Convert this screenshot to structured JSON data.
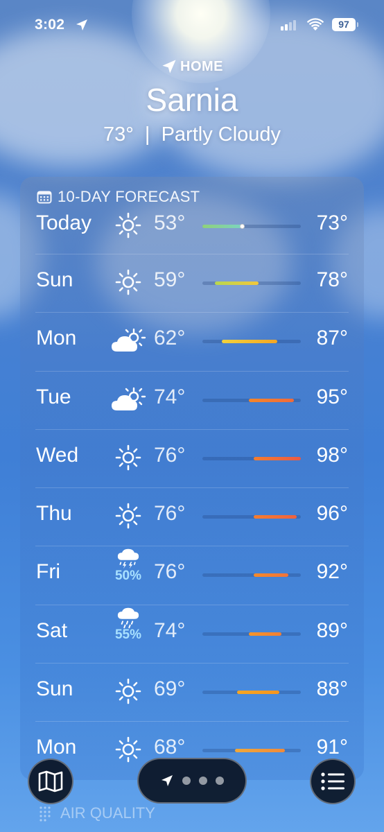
{
  "status": {
    "time": "3:02",
    "battery": "97"
  },
  "header": {
    "location_label": "HOME",
    "city": "Sarnia",
    "conditions": "73°  |  Partly Cloudy"
  },
  "forecast": {
    "title": "10-DAY FORECAST",
    "rows": [
      {
        "day": "Today",
        "icon": "sun-icon",
        "precip": "",
        "low": "53°",
        "high": "73°",
        "bar_start": 0.0,
        "bar_end": 0.4,
        "current": 0.4,
        "bar_color": "linear-gradient(90deg,#8fd27a,#7bd3c0)"
      },
      {
        "day": "Sun",
        "icon": "sun-icon",
        "precip": "",
        "low": "59°",
        "high": "78°",
        "bar_start": 0.13,
        "bar_end": 0.57,
        "bar_color": "linear-gradient(90deg,#b8d74f,#f2c73c)"
      },
      {
        "day": "Mon",
        "icon": "partly-cloudy-icon",
        "precip": "",
        "low": "62°",
        "high": "87°",
        "bar_start": 0.2,
        "bar_end": 0.76,
        "bar_color": "linear-gradient(90deg,#f2d23c,#f5a623)"
      },
      {
        "day": "Tue",
        "icon": "partly-cloudy-icon",
        "precip": "",
        "low": "74°",
        "high": "95°",
        "bar_start": 0.47,
        "bar_end": 0.93,
        "bar_color": "linear-gradient(90deg,#f5862a,#f06a3a)"
      },
      {
        "day": "Wed",
        "icon": "sun-icon",
        "precip": "",
        "low": "76°",
        "high": "98°",
        "bar_start": 0.52,
        "bar_end": 1.0,
        "bar_color": "linear-gradient(90deg,#f57d2e,#ea5a45)"
      },
      {
        "day": "Thu",
        "icon": "sun-icon",
        "precip": "",
        "low": "76°",
        "high": "96°",
        "bar_start": 0.52,
        "bar_end": 0.96,
        "bar_color": "linear-gradient(90deg,#f57d2e,#ee6240)"
      },
      {
        "day": "Fri",
        "icon": "thunderstorm-icon",
        "precip": "50%",
        "low": "76°",
        "high": "92°",
        "bar_start": 0.52,
        "bar_end": 0.87,
        "bar_color": "linear-gradient(90deg,#f58a2a,#f0733a)"
      },
      {
        "day": "Sat",
        "icon": "rain-icon",
        "precip": "55%",
        "low": "74°",
        "high": "89°",
        "bar_start": 0.47,
        "bar_end": 0.8,
        "bar_color": "linear-gradient(90deg,#f5952a,#f27f34)"
      },
      {
        "day": "Sun",
        "icon": "sun-icon",
        "precip": "",
        "low": "69°",
        "high": "88°",
        "bar_start": 0.35,
        "bar_end": 0.78,
        "bar_color": "linear-gradient(90deg,#f5a623,#f5951f)"
      },
      {
        "day": "Mon",
        "icon": "sun-icon",
        "precip": "",
        "low": "68°",
        "high": "91°",
        "bar_start": 0.33,
        "bar_end": 0.84,
        "bar_color": "linear-gradient(90deg,#f0a83a,#f08a3a)"
      }
    ]
  },
  "air_quality": {
    "title": "AIR QUALITY"
  },
  "bottom_bar": {
    "page_count": 3
  }
}
